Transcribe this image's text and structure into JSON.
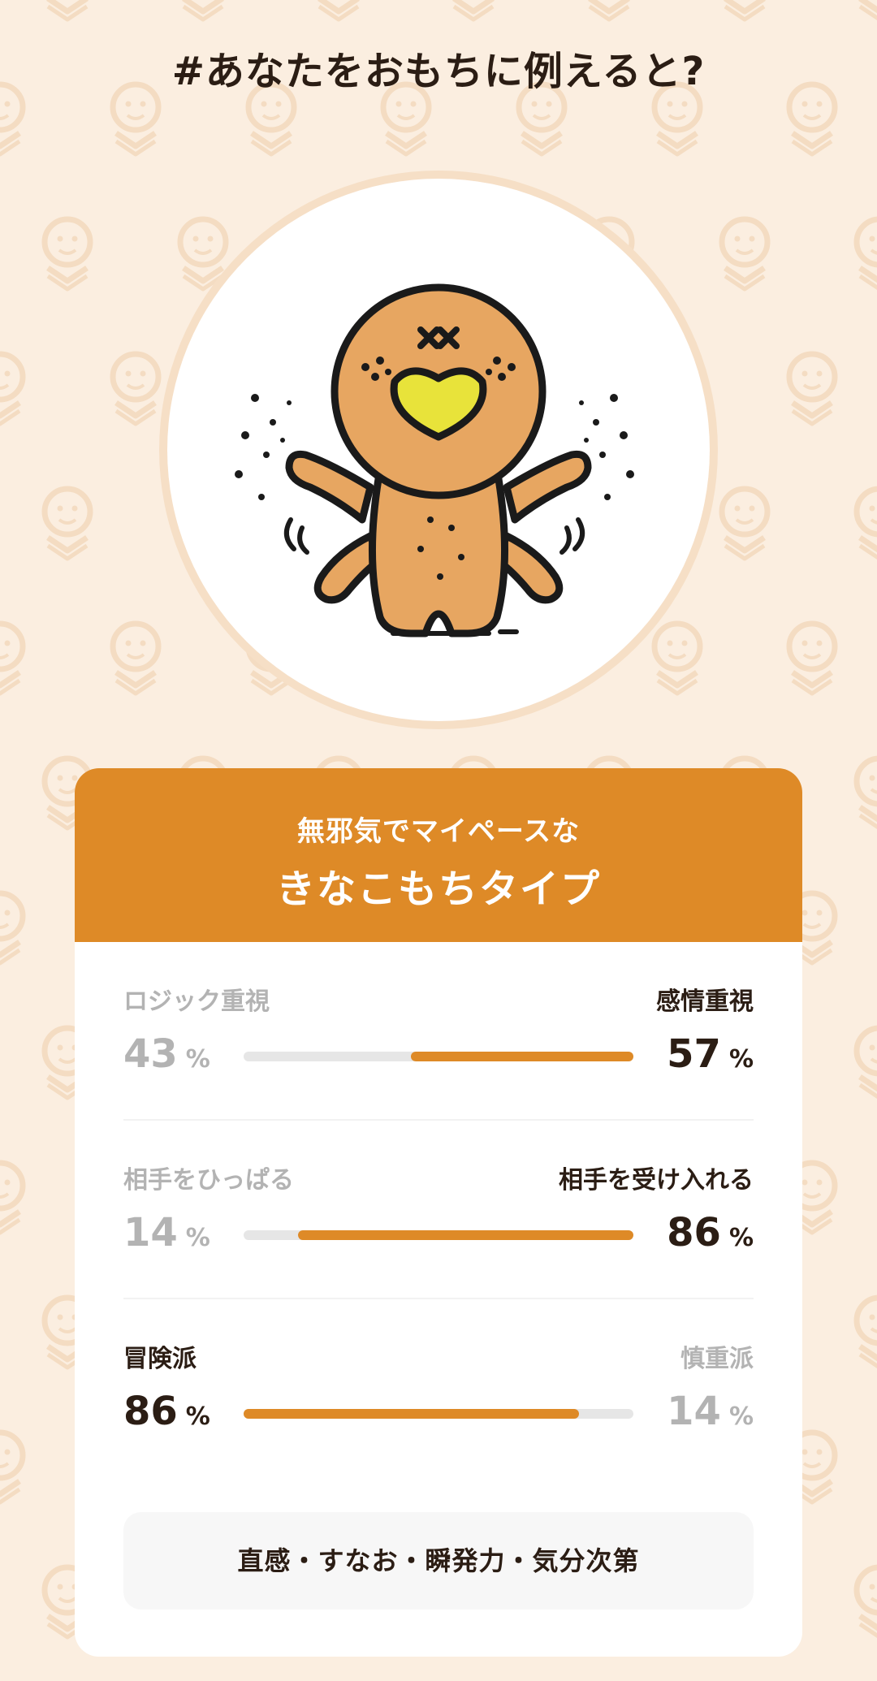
{
  "page": {
    "title": "#あなたをおもちに例えると?"
  },
  "avatar": {
    "icon": "kinako-mochi-character-icon"
  },
  "result": {
    "subtitle": "無邪気でマイペースな",
    "type_name": "きなこもちタイプ"
  },
  "traits": [
    {
      "left_label": "ロジック重視",
      "left_value": "43",
      "right_label": "感情重視",
      "right_value": "57",
      "unit": "%",
      "fill_from": "right",
      "fill_percent": 57,
      "strong_side": "right"
    },
    {
      "left_label": "相手をひっぱる",
      "left_value": "14",
      "right_label": "相手を受け入れる",
      "right_value": "86",
      "unit": "%",
      "fill_from": "right",
      "fill_percent": 86,
      "strong_side": "right"
    },
    {
      "left_label": "冒険派",
      "left_value": "86",
      "right_label": "慎重派",
      "right_value": "14",
      "unit": "%",
      "fill_from": "left",
      "fill_percent": 86,
      "strong_side": "left"
    }
  ],
  "keywords": "直感・すなお・瞬発力・気分次第",
  "colors": {
    "accent": "#de8a27",
    "background": "#fbeee0",
    "text": "#2b1d14",
    "muted": "#b3b3b3"
  }
}
